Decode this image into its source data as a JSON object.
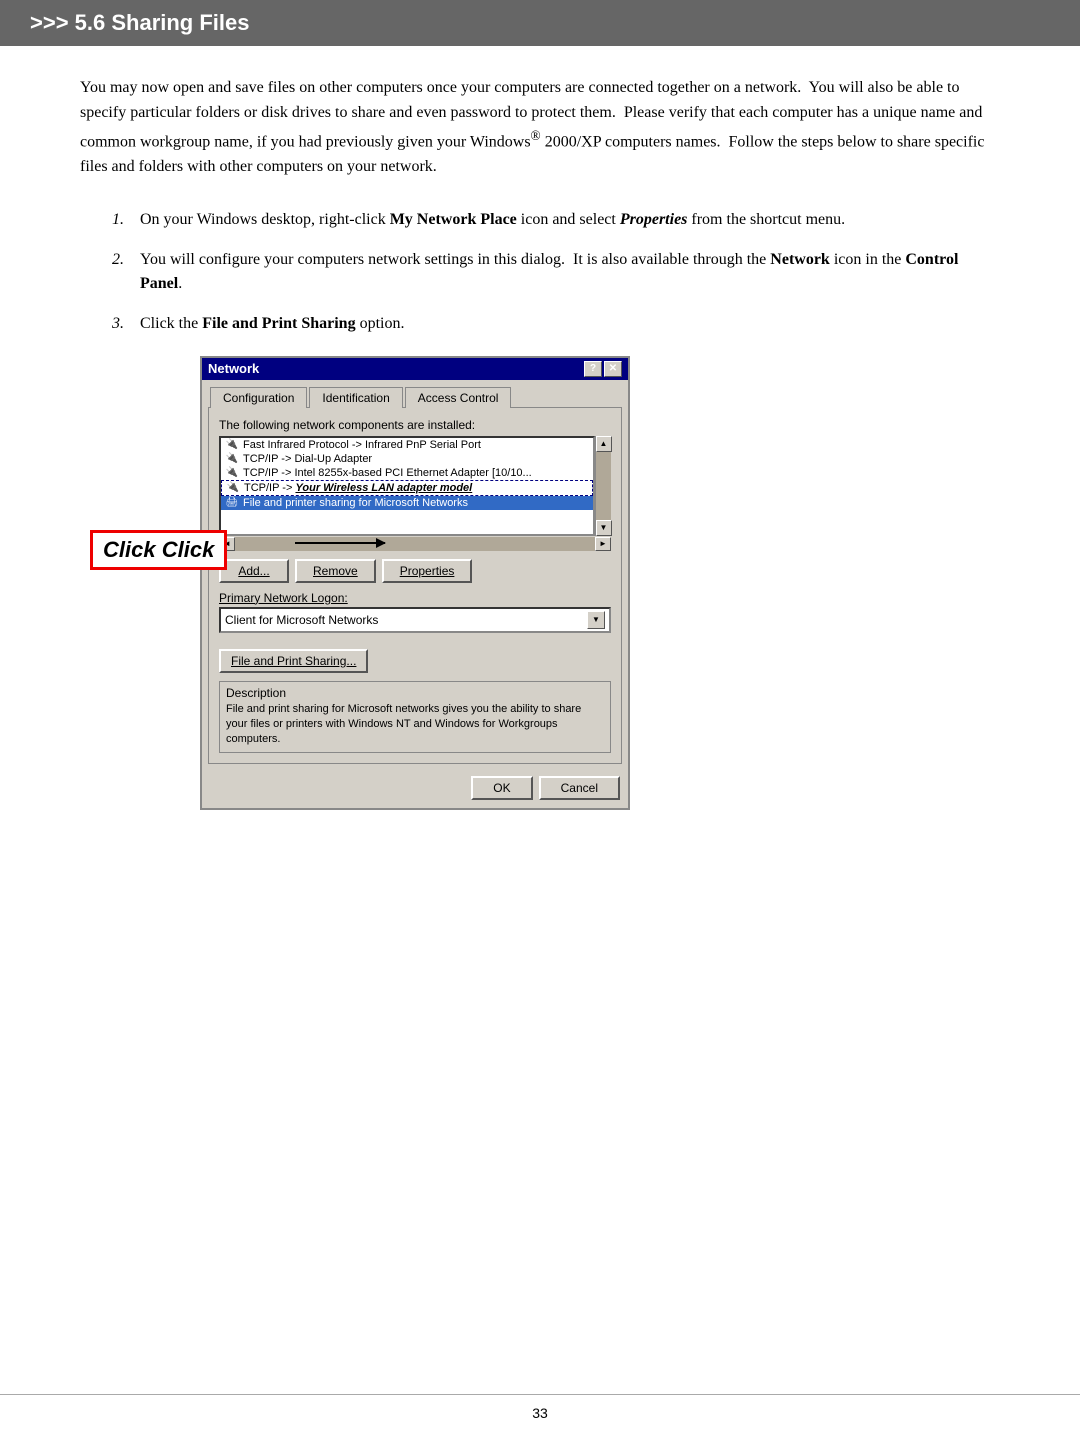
{
  "header": {
    "label": ">>> 5.6  Sharing Files"
  },
  "intro": {
    "text": "You may now open and save files on other computers once your computers are connected together on a network.  You will also be able to specify particular folders or disk drives to share and even password to protect them.  Please verify that each computer has a unique name and common workgroup name, if you had previously given your Windows® 2000/XP computers names.  Follow the steps below to share specific files and folders with other computers on your network."
  },
  "steps": [
    {
      "number": "1.",
      "text_plain": "On your Windows desktop, right-click ",
      "bold1": "My Network Place",
      "text_mid": " icon and select ",
      "italic1": "Properties",
      "text_end": " from the shortcut menu."
    },
    {
      "number": "2.",
      "text_plain": "You will configure your computers network settings in this dialog.  It is also available through the ",
      "bold1": "Network",
      "text_mid": " icon in the ",
      "bold2": "Control Panel",
      "text_end": "."
    },
    {
      "number": "3.",
      "text_plain": "Click the ",
      "bold1": "File and Print Sharing",
      "text_end": " option."
    }
  ],
  "dialog": {
    "title": "Network",
    "tabs": [
      "Configuration",
      "Identification",
      "Access Control"
    ],
    "active_tab": "Configuration",
    "network_label": "The following network components are installed:",
    "list_items": [
      {
        "text": "Fast Infrared Protocol -> Infrared PnP Serial Port",
        "selected": false
      },
      {
        "text": "TCP/IP -> Dial-Up Adapter",
        "selected": false
      },
      {
        "text": "TCP/IP -> Intel 8255x-based PCI Ethernet Adapter [10/10...",
        "selected": false
      },
      {
        "text": "TCP/IP ->  Your Wireless LAN adapter model",
        "selected": true,
        "bold": true
      },
      {
        "text": "File and printer sharing for Microsoft Networks",
        "selected": true
      }
    ],
    "buttons": {
      "add": "Add...",
      "remove": "Remove",
      "properties": "Properties"
    },
    "primary_logon_label": "Primary Network Logon:",
    "primary_logon_value": "Client for Microsoft Networks",
    "sharing_btn": "File and Print Sharing...",
    "description_label": "Description",
    "description_text": "File and print sharing for Microsoft networks gives you the ability to share your files or printers with Windows NT and Windows for Workgroups computers.",
    "ok_label": "OK",
    "cancel_label": "Cancel"
  },
  "click_label": "Click",
  "page_number": "33"
}
